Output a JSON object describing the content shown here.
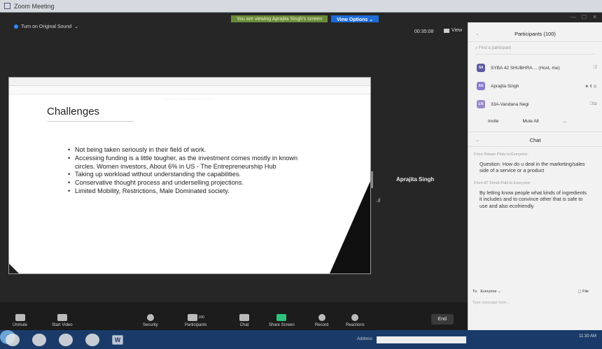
{
  "window": {
    "title": "Zoom Meeting"
  },
  "share_bar": {
    "viewing_text": "You are viewing Aprajita Singh's screen",
    "view_options": "View Options ⌄"
  },
  "stage": {
    "original_sound": "Turn on Original Sound",
    "timer": "00:35:08",
    "view_label": "View",
    "speaker_name": "Aprajita Singh"
  },
  "slide": {
    "browser_tab": "...",
    "address": "...",
    "title": "Challenges",
    "bullets": [
      "Not being taken seriously in their field of work.",
      "Accessing funding is a little tougher, as the investment comes mostly in known circles. Women investors, About 6% in US - The Entrepreneurship Hub",
      "Taking up workload without understanding the capabilities.",
      "Conservative thought process and underselling projections.",
      "Limited Mobility, Restrictions, Male Dominated society."
    ]
  },
  "toolbar": {
    "unmute": "Unmute",
    "start_video": "Start Video",
    "security": "Security",
    "participants": "Participants",
    "participants_count": "100",
    "chat": "Chat",
    "share_screen": "Share Screen",
    "record": "Record",
    "reactions": "Reactions",
    "end": "End"
  },
  "participants_panel": {
    "title": "Participants (100)",
    "search_placeholder": "Find a participant",
    "rows": [
      {
        "initials": "S4",
        "name": "SYBA 42 SHUBHRA ... (Host, me)",
        "color": "#5b5ba0"
      },
      {
        "initials": "AS",
        "name": "Aprajita Singh",
        "color": "#8a7ad0"
      },
      {
        "initials": "LN",
        "name": "33A-Vandana Negi",
        "color": "#9a8ac8"
      }
    ],
    "invite": "Invite",
    "mute_all": "Mute All",
    "more": "..."
  },
  "chat_panel": {
    "title": "Chat",
    "messages": [
      {
        "from": "From Rowan Pinto to Everyone:",
        "text": "Question: How do u deal in the marketing/sales side of a service or a product"
      },
      {
        "from": "From 87 Shrab Patil to Everyone:",
        "text": "By letting know people what kinds of ingredients it includes and to convince other that is safe to use and also ecofriendly"
      }
    ],
    "to_label": "To:",
    "to_value": "Everyone ⌄",
    "file_label": "File",
    "input_placeholder": "Type message here..."
  },
  "taskbar": {
    "address_label": "Address",
    "clock": "11:30 AM",
    "word_label": "W"
  }
}
